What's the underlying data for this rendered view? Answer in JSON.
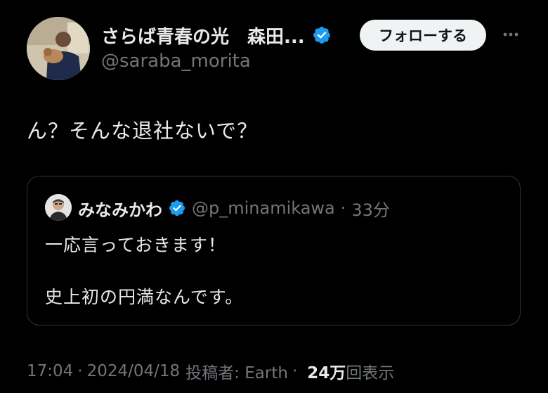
{
  "author": {
    "display_name": "さらば青春の光　森田...",
    "handle": "@saraba_morita",
    "verified": true
  },
  "follow_button_label": "フォローする",
  "more_icon": "more-horizontal-icon",
  "tweet_text": "ん？そんな退社ないで？",
  "quoted_tweet": {
    "display_name": "みなみかわ",
    "handle": "@p_minamikawa",
    "separator": "·",
    "time_ago": "33分",
    "line1": "一応言っておきます！",
    "line2": "史上初の円満なんです。"
  },
  "meta": {
    "time": "17:04",
    "separator": "·",
    "date": "2024/04/18",
    "posted_by": "投稿者: Earth",
    "views_number": "24万",
    "views_label": "回表示"
  },
  "colors": {
    "background": "#000000",
    "text": "#e7e9ea",
    "secondary": "#71767b",
    "verified_blue": "#1d9bf0",
    "follow_bg": "#eff3f4"
  }
}
